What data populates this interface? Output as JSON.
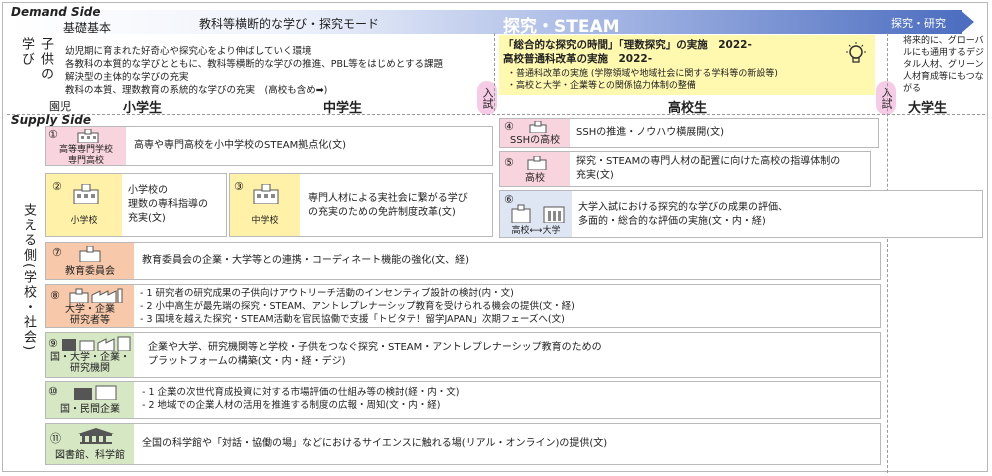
{
  "labels": {
    "demand_side": "Demand Side",
    "supply_side": "Supply Side",
    "kiso": "基礎基本",
    "cross": "教科等横断的な学び・探究モード",
    "steam": "探究・STEAM",
    "tankyu_kenkyu": "探究・研究",
    "children_learning": "子供の学び",
    "support_side": "支える側(学校・社会)",
    "nyushi": "入試"
  },
  "demand_lines": [
    "幼児期に育まれた好奇心や探究心をより伸ばしていく環境",
    "各教科の本質的な学びとともに、教科等横断的な学びの推進、PBL等をはじめとする課題",
    "解決型の主体的な学びの充実",
    "教科の本質、理数教育の系統的な学びの充実　(高校も含め➡)"
  ],
  "highschool_box": {
    "title1": "「総合的な探究の時間」「理数探究」の実施　2022-",
    "title2": "高校普通科改革の実施　2022-",
    "bullet1": "・普通科改革の実施 (学際領域や地域社会に関する学科等の新設等)",
    "bullet2": "・高校と大学・企業等との関係協力体制の整備"
  },
  "future_note": "将来的に、グローバルにも通用するデジタル人材、グリーン人材育成等にもつながる",
  "stages": {
    "enji": "園児",
    "elementary": "小学生",
    "junior": "中学生",
    "high": "高校生",
    "univ": "大学生"
  },
  "supply": {
    "r1": {
      "num": "①",
      "label": "高等専門学校\n専門高校",
      "text": "高専や専門高校を小中学校のSTEAM拠点化(文)"
    },
    "r2": {
      "num": "②",
      "label": "小学校",
      "text": "小学校の\n理数の専科指導の\n充実(文)"
    },
    "r3": {
      "num": "③",
      "label": "中学校",
      "text": "専門人材による実社会に繋がる学び\nの充実のための免許制度改革(文)"
    },
    "r4": {
      "num": "④",
      "label": "SSHの高校",
      "text": "SSHの推進・ノウハウ横展開(文)"
    },
    "r5": {
      "num": "⑤",
      "label": "高校",
      "text": "探究・STEAMの専門人材の配置に向けた高校の指導体制の\n充実(文)"
    },
    "r6": {
      "num": "⑥",
      "label": "高校⟷大学",
      "text": "大学入試における探究的な学びの成果の評価、\n多面的・総合的な評価の実施(文・内・経)"
    },
    "r7": {
      "num": "⑦",
      "label": "教育委員会",
      "text": "教育委員会の企業・大学等との連携・コーディネート機能の強化(文、経)"
    },
    "r8": {
      "num": "⑧",
      "label": "大学・企業\n研究者等",
      "lines": [
        "- 1 研究者の研究成果の子供向けアウトリーチ活動のインセンティブ設計の検討(内・文)",
        "- 2 小中高生が最先端の探究・STEAM、アントレプレナーシップ教育を受けられる機会の提供(文・経)",
        "- 3 国境を越えた探究・STEAM活動を官民協働で支援「トビタテ！留学JAPAN」次期フェーズへ(文)"
      ]
    },
    "r9": {
      "num": "⑨",
      "label": "国・大学・企業・\n研究機関",
      "text": "企業や大学、研究機関等と学校・子供をつなぐ探究・STEAM・アントレプレナーシップ教育のための\nプラットフォームの構築(文・内・経・デジ)"
    },
    "r10": {
      "num": "⑩",
      "label": "国・民間企業",
      "lines": [
        "- 1 企業の次世代育成投資に対する市場評価の仕組み等の検討(経・内・文)",
        "- 2 地域での企業人材の活用を推進する制度の広報・周知(文・内・経)"
      ]
    },
    "r11": {
      "num": "⑪",
      "label": "図書館、科学館",
      "text": "全国の科学館や「対話・協働の場」などにおけるサイエンスに触れる場(リアル・オンライン)の提供(文)"
    }
  },
  "icons": [
    "school-building-icon",
    "lightbulb-icon",
    "factory-icon",
    "museum-icon"
  ]
}
